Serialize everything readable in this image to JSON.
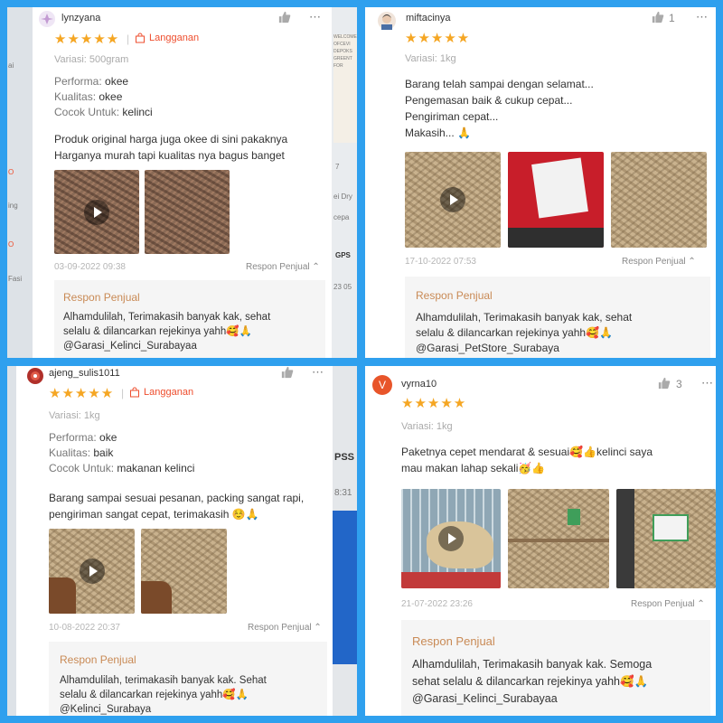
{
  "colors": {
    "frame": "#2fa0ee",
    "star": "#f5a623",
    "accent": "#ee4d2d",
    "reply_title": "#c98a55"
  },
  "icons": {
    "like": "thumbs-up-icon",
    "more": "more-dots-icon",
    "play": "play-icon",
    "bag": "shopping-bag-icon",
    "chevron": "chevron-up-icon"
  },
  "reviews": [
    {
      "username": "lynzyana",
      "rating": 5,
      "stars": "★★★★★",
      "badge": "Langganan",
      "variasi": "Variasi: 500gram",
      "attrs": [
        {
          "label": "Performa:",
          "value": "okee"
        },
        {
          "label": "Kualitas:",
          "value": "okee"
        },
        {
          "label": "Cocok Untuk:",
          "value": "kelinci"
        }
      ],
      "text_lines": [
        "Produk original harga juga okee di sini pakaknya",
        "Harganya murah tapi kualitas nya bagus banget"
      ],
      "date": "03-09-2022 09:38",
      "respon_link": "Respon Penjual",
      "reply_title": "Respon Penjual",
      "reply_lines": [
        "Alhamdulilah, Terimakasih banyak kak, sehat",
        "selalu & dilancarkan rejekinya yahh🥰🙏",
        "@Garasi_Kelinci_Surabayaa"
      ]
    },
    {
      "username": "miftacinya",
      "rating": 5,
      "stars": "★★★★★",
      "likes": "1",
      "variasi": "Variasi: 1kg",
      "text_lines": [
        "Barang telah sampai dengan selamat...",
        "Pengemasan baik & cukup cepat...",
        "Pengiriman cepat...",
        "Makasih... 🙏"
      ],
      "date": "17-10-2022 07:53",
      "respon_link": "Respon Penjual",
      "reply_title": "Respon Penjual",
      "reply_lines": [
        "Alhamdulilah, Terimakasih banyak kak, sehat",
        "selalu & dilancarkan rejekinya yahh🥰🙏",
        "@Garasi_PetStore_Surabaya"
      ]
    },
    {
      "username": "ajeng_sulis1011",
      "rating": 5,
      "stars": "★★★★★",
      "badge": "Langganan",
      "variasi": "Variasi: 1kg",
      "attrs": [
        {
          "label": "Performa:",
          "value": "oke"
        },
        {
          "label": "Kualitas:",
          "value": "baik"
        },
        {
          "label": "Cocok Untuk:",
          "value": "makanan kelinci"
        }
      ],
      "text_lines": [
        "Barang sampai sesuai pesanan, packing sangat rapi,",
        "pengiriman sangat cepat, terimakasih ☺️🙏"
      ],
      "date": "10-08-2022 20:37",
      "respon_link": "Respon Penjual",
      "reply_title": "Respon Penjual",
      "reply_lines": [
        "Alhamdulilah, terimakasih banyak kak. Sehat",
        "selalu & dilancarkan rejekinya yahh🥰🙏",
        "@Kelinci_Surabaya"
      ]
    },
    {
      "username": "vyrna10",
      "avatar_letter": "V",
      "rating": 5,
      "stars": "★★★★★",
      "likes": "3",
      "variasi": "Variasi: 1kg",
      "text_lines": [
        "Paketnya cepet mendarat & sesuai🥰👍kelinci saya",
        "mau makan lahap sekali🥳👍"
      ],
      "date": "21-07-2022 23:26",
      "respon_link": "Respon Penjual",
      "reply_title": "Respon Penjual",
      "reply_lines": [
        "Alhamdulilah, Terimakasih banyak kak. Semoga",
        "sehat selalu & dilancarkan rejekinya yahh🥰🙏",
        "@Garasi_Kelinci_Surabayaa"
      ]
    }
  ],
  "background_fragments": {
    "p1_left": [
      "ai",
      "O",
      "ing",
      "O",
      "Fasi"
    ],
    "p1_right": [
      "WELCOME",
      "OFCEVI",
      "DEPOKS",
      "GREENT",
      "FOR",
      "7",
      "ei Dry",
      "cepa",
      "GPS",
      "23 05"
    ],
    "p3_right": [
      "PSS",
      "8:31"
    ]
  }
}
